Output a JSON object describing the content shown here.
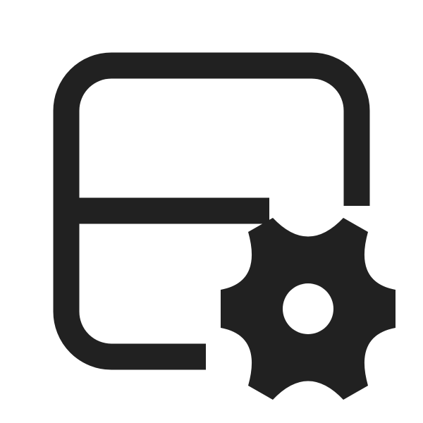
{
  "icon": {
    "name": "table-settings-icon",
    "color": "#212121",
    "background": "#ffffff"
  }
}
